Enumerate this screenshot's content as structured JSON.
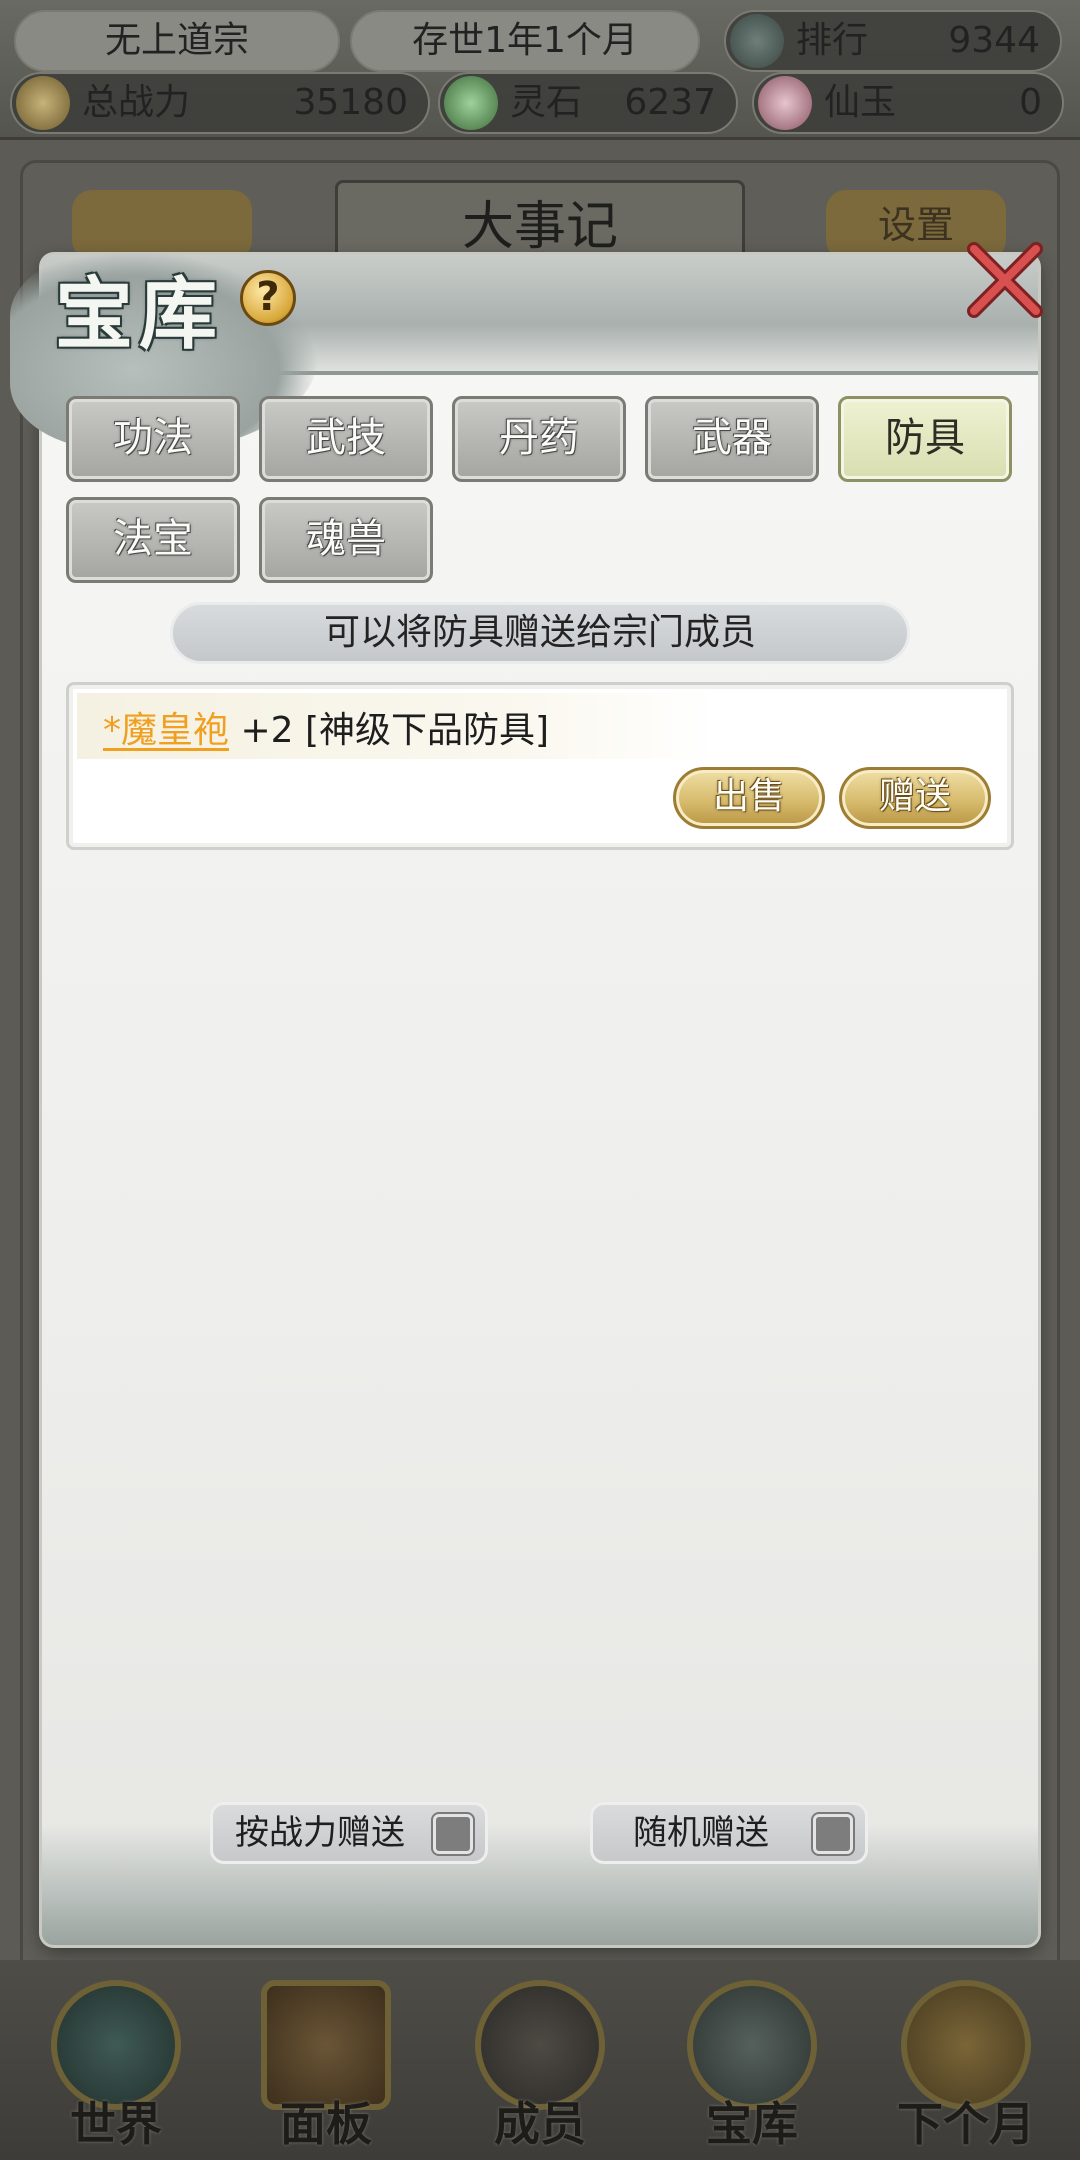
{
  "topbar": {
    "sect_name": "无上道宗",
    "era": "存世1年1个月",
    "rank_label": "排行",
    "rank_value": "9344",
    "power_label": "总战力",
    "power_value": "35180",
    "spirit_stone_label": "灵石",
    "spirit_stone_value": "6237",
    "jade_label": "仙玉",
    "jade_value": "0"
  },
  "background": {
    "title": "大事记",
    "settings_label": "设置"
  },
  "dialog": {
    "title": "宝库",
    "help_symbol": "?",
    "tabs": [
      {
        "label": "功法"
      },
      {
        "label": "武技"
      },
      {
        "label": "丹药"
      },
      {
        "label": "武器"
      },
      {
        "label": "防具",
        "active": true
      },
      {
        "label": "法宝"
      },
      {
        "label": "魂兽"
      }
    ],
    "notice": "可以将防具赠送给宗门成员",
    "items": [
      {
        "name": "*魔皇袍",
        "detail": " +2 [神级下品防具]",
        "sell_label": "出售",
        "gift_label": "赠送"
      }
    ],
    "toggles": {
      "by_power_label": "按战力赠送",
      "by_power_checked": false,
      "random_label": "随机赠送",
      "random_checked": false
    }
  },
  "nav": {
    "items": [
      {
        "label": "世界"
      },
      {
        "label": "面板"
      },
      {
        "label": "成员"
      },
      {
        "label": "宝库"
      },
      {
        "label": "下个月"
      }
    ]
  },
  "colors": {
    "item_name": "#f0a020",
    "active_tab": "#d8deb0",
    "gold_button": "#d8bc6e"
  }
}
